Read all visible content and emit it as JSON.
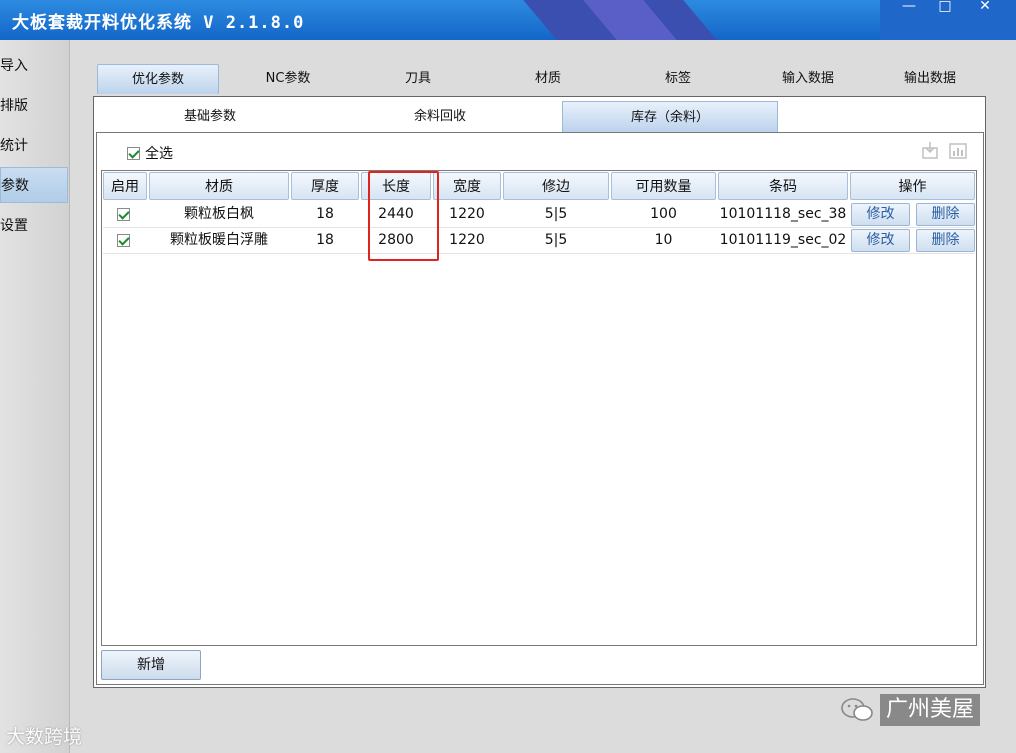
{
  "app": {
    "title": "大板套裁开料优化系统 V 2.1.8.0",
    "window_controls": [
      "—",
      "□",
      "✕"
    ]
  },
  "leftnav": {
    "items": [
      {
        "label": "导入",
        "active": false
      },
      {
        "label": "排版",
        "active": false
      },
      {
        "label": "统计",
        "active": false
      },
      {
        "label": "参数",
        "active": true
      },
      {
        "label": "设置",
        "active": false
      }
    ]
  },
  "top_tabs": [
    "优化参数",
    "NC参数",
    "刀具",
    "材质",
    "标签",
    "输入数据",
    "输出数据"
  ],
  "sub_tabs": [
    "基础参数",
    "余料回收",
    "库存（余料）"
  ],
  "select_all_label": "全选",
  "table": {
    "headers": [
      "启用",
      "材质",
      "厚度",
      "长度",
      "宽度",
      "修边",
      "可用数量",
      "条码",
      "操作"
    ],
    "rows": [
      {
        "enabled": true,
        "material": "颗粒板白枫",
        "thickness": "18",
        "length": "2440",
        "width": "1220",
        "trim": "5|5",
        "qty": "100",
        "barcode": "10101118_sec_38",
        "edit": "修改",
        "delete": "删除"
      },
      {
        "enabled": true,
        "material": "颗粒板暖白浮雕",
        "thickness": "18",
        "length": "2800",
        "width": "1220",
        "trim": "5|5",
        "qty": "10",
        "barcode": "10101119_sec_02",
        "edit": "修改",
        "delete": "删除"
      }
    ]
  },
  "add_button_label": "新增",
  "watermarks": {
    "left": "大数跨境",
    "right": "广州美屋"
  },
  "colors": {
    "titlebar": "#1f6fd3",
    "highlight": "#e0231c",
    "check": "#1b8a2b"
  }
}
